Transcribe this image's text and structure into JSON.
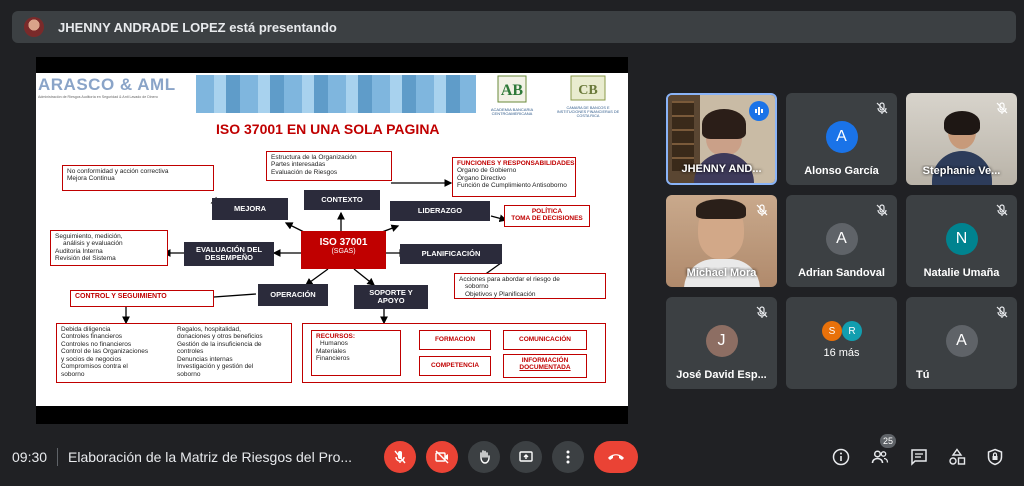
{
  "banner": {
    "text": "JHENNY ANDRADE LOPEZ está presentando"
  },
  "slide": {
    "logo_left": "ARASCO & AML",
    "logo_left_sub": "Administración de Riesgos Auditoría en Seguridad & Anti Lavado de Dinero",
    "logo_mid": "ACADEMIA BANCARIA CENTROAMERICANA",
    "logo_right": "CAMARA DE BANCOS E INSTITUCIONES FINANCIERAS DE COSTA RICA",
    "title": "ISO 37001 EN UNA SOLA PAGINA",
    "center_main": "ISO 37001",
    "center_sub": "(SGAS)",
    "contexto": "CONTEXTO",
    "contexto_box": [
      "Estructura de la Organización",
      "Partes interesadas",
      "Evaluación de Riesgos"
    ],
    "mejora": "MEJORA",
    "mejora_box": [
      "No conformidad y acción correctiva",
      "Mejora Continua"
    ],
    "liderazgo": "LIDERAZGO",
    "funciones_title": "FUNCIONES Y RESPONSABILIDADES:",
    "funciones_box": [
      "Organo de Gobierno",
      "Órgano Directivo",
      "Función de Cumplimiento Antisoborno"
    ],
    "politica_box": [
      "POLÍTICA",
      "TOMA DE DECISIONES"
    ],
    "evaluacion": [
      "EVALUACIÓN DEL",
      "DESEMPEÑO"
    ],
    "seguimiento_box": [
      "Seguimiento, medición,",
      "análisis y evaluación",
      "Auditoria Interna",
      "Revisión del Sistema"
    ],
    "planificacion": "PLANIFICACIÓN",
    "acciones_box": [
      "Acciones para abordar el riesgo de",
      "soborno",
      "Objetivos y Planificación"
    ],
    "operacion": "OPERACIÓN",
    "soporte": [
      "SOPORTE Y",
      "APOYO"
    ],
    "control": "CONTROL Y SEGUIMIENTO",
    "control_left": [
      "Debida diligencia",
      "Controles financieros",
      "Controles no financieros",
      "Control de las Organizaciones",
      "y socios de negocios",
      "Compromisos contra el",
      "soborno"
    ],
    "control_right": [
      "Regalos, hospitalidad,",
      "donaciones y otros beneficios",
      "Gestión de la insuficiencia de",
      "controles",
      "Denuncias internas",
      "Investigación y gestión del",
      "soborno"
    ],
    "recursos_title": "RECURSOS:",
    "recursos": [
      "Humanos",
      "Materiales",
      "Financieros"
    ],
    "formacion": "FORMACION",
    "comunicacion": "COMUNICACIÓN",
    "competencia": "COMPETENCIA",
    "informacion": [
      "INFORMACIÓN",
      "DOCUMENTADA"
    ]
  },
  "participants": [
    {
      "name": "JHENNY AND...",
      "type": "photo"
    },
    {
      "name": "Alonso García",
      "initial": "A",
      "color": "#1a73e8"
    },
    {
      "name": "Stephanie Ve...",
      "type": "photo"
    },
    {
      "name": "Michael Mora",
      "type": "photo"
    },
    {
      "name": "Adrian Sandoval",
      "initial": "A",
      "color": "#5f6368"
    },
    {
      "name": "Natalie Umaña",
      "initial": "N",
      "color": "#00838f"
    },
    {
      "name": "José David Esp...",
      "initial": "J",
      "color": "#8d6e63"
    },
    {
      "name": "16 más",
      "initials": [
        "S",
        "R"
      ],
      "colors": [
        "#e8710a",
        "#129eaf"
      ]
    },
    {
      "name": "Tú",
      "initial": "A",
      "color": "#5f6368"
    }
  ],
  "bottom": {
    "time": "09:30",
    "title": "Elaboración de la Matriz de Riesgos del Pro...",
    "people_count": "25"
  },
  "colors": {
    "background": "#202124",
    "tile": "#3c4043",
    "danger": "#ea4335",
    "slide_red": "#c00000",
    "slide_dark": "#2b2b3b"
  },
  "icons": [
    "mic-off-icon",
    "camera-off-icon",
    "raise-hand-icon",
    "present-icon",
    "more-options-icon",
    "end-call-icon",
    "info-icon",
    "people-icon",
    "chat-icon",
    "activities-icon",
    "host-controls-icon",
    "speaking-icon"
  ]
}
